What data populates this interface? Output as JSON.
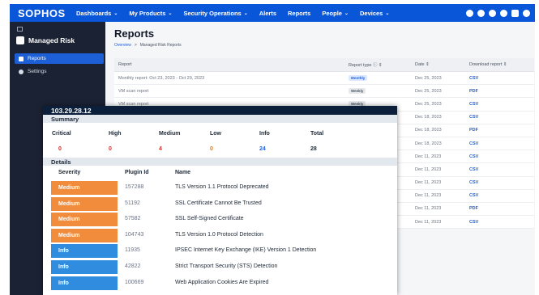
{
  "colors": {
    "nav_blue": "#0a56d8",
    "sidebar_bg": "#1b2233",
    "medium": "#f08c3c",
    "info": "#2f8cdf",
    "critical": "#d22b2b",
    "high": "#d22b2b",
    "medium_text": "#d22b2b",
    "low": "#e07a14",
    "info_text": "#1c5fd6",
    "total": "#1f2937"
  },
  "topnav": {
    "logo": "SOPHOS",
    "items": [
      {
        "label": "Dashboards",
        "dropdown": true
      },
      {
        "label": "My Products",
        "dropdown": true
      },
      {
        "label": "Security Operations",
        "dropdown": true
      },
      {
        "label": "Alerts",
        "dropdown": false
      },
      {
        "label": "Reports",
        "dropdown": false
      },
      {
        "label": "People",
        "dropdown": true
      },
      {
        "label": "Devices",
        "dropdown": true
      }
    ],
    "chevron": "⌄",
    "icons": [
      "globe-icon",
      "gear-icon",
      "sun-icon",
      "help-icon",
      "bell-icon",
      "user-icon"
    ]
  },
  "sidebar": {
    "workspace": "Managed Risk",
    "items": [
      {
        "label": "Reports",
        "icon": "reports-icon",
        "active": true
      },
      {
        "label": "Settings",
        "icon": "gear-icon",
        "active": false
      }
    ]
  },
  "main": {
    "title": "Reports",
    "breadcrumb": {
      "link": "Overview",
      "sep": ">",
      "current": "Managed Risk Reports"
    }
  },
  "reports": {
    "headers": {
      "report": "Report",
      "type": "Report type",
      "date": "Date",
      "download": "Download report"
    },
    "sort_glyph": "⇕",
    "rows": [
      {
        "report": "Monthly report: Oct 23, 2023 - Oct 29, 2023",
        "type": "Monthly",
        "date": "Dec 25, 2023",
        "download": "CSV"
      },
      {
        "report": "VM scan report",
        "type": "Weekly",
        "date": "Dec 25, 2023",
        "download": "PDF"
      },
      {
        "report": "VM scan report",
        "type": "Weekly",
        "date": "Dec 25, 2023",
        "download": "CSV"
      },
      {
        "report": "",
        "type": "",
        "date": "Dec 18, 2023",
        "download": "CSV"
      },
      {
        "report": "",
        "type": "",
        "date": "Dec 18, 2023",
        "download": "PDF"
      },
      {
        "report": "",
        "type": "",
        "date": "Dec 18, 2023",
        "download": "CSV"
      },
      {
        "report": "",
        "type": "",
        "date": "Dec 11, 2023",
        "download": "CSV"
      },
      {
        "report": "",
        "type": "",
        "date": "Dec 11, 2023",
        "download": "CSV"
      },
      {
        "report": "",
        "type": "",
        "date": "Dec 11, 2023",
        "download": "CSV"
      },
      {
        "report": "",
        "type": "",
        "date": "Dec 11, 2023",
        "download": "CSV"
      },
      {
        "report": "",
        "type": "",
        "date": "Dec 11, 2023",
        "download": "PDF"
      },
      {
        "report": "",
        "type": "",
        "date": "Dec 11, 2023",
        "download": "CSV"
      }
    ]
  },
  "card": {
    "ip": "103.29.28.12",
    "summary_title": "Summary",
    "summary_headers": [
      "Critical",
      "High",
      "Medium",
      "Low",
      "Info",
      "Total"
    ],
    "summary_values": [
      "0",
      "0",
      "4",
      "0",
      "24",
      "28"
    ],
    "details_title": "Details",
    "details_headers": {
      "severity": "Severity",
      "plugin": "Plugin Id",
      "name": "Name"
    },
    "details": [
      {
        "severity": "Medium",
        "plugin": "157288",
        "name": "TLS Version 1.1 Protocol Deprecated"
      },
      {
        "severity": "Medium",
        "plugin": "51192",
        "name": "SSL Certificate Cannot Be Trusted"
      },
      {
        "severity": "Medium",
        "plugin": "57582",
        "name": "SSL Self-Signed Certificate"
      },
      {
        "severity": "Medium",
        "plugin": "104743",
        "name": "TLS Version 1.0 Protocol Detection"
      },
      {
        "severity": "Info",
        "plugin": "11935",
        "name": "IPSEC Internet Key Exchange (IKE) Version 1 Detection"
      },
      {
        "severity": "Info",
        "plugin": "42822",
        "name": "Strict Transport Security (STS) Detection"
      },
      {
        "severity": "Info",
        "plugin": "100669",
        "name": "Web Application Cookies Are Expired"
      }
    ]
  }
}
